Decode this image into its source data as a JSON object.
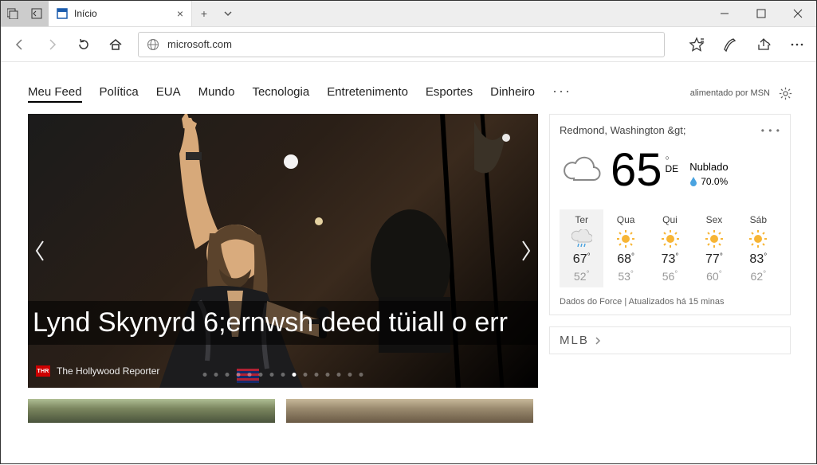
{
  "tab": {
    "title": "Início"
  },
  "address": {
    "url": "microsoft.com"
  },
  "nav": {
    "items": [
      "Meu Feed",
      "Política",
      "EUA",
      "Mundo",
      "Tecnologia",
      "Entretenimento",
      "Esportes",
      "Dinheiro"
    ],
    "active_index": 0,
    "more": "···",
    "powered_by": "alimentado por MSN"
  },
  "hero": {
    "headline": "Lynd Skynyrd 6;ernwsh deed tüiall o err",
    "source": "The Hollywood Reporter",
    "src_badge": "THR",
    "dot_count": 15,
    "active_dot": 8
  },
  "weather": {
    "location": "Redmond, Washington &gt;",
    "temp": "65",
    "unit": "DE",
    "condition": "Nublado",
    "humidity": "70.0%",
    "days": [
      {
        "name": "Ter",
        "icon": "rain",
        "hi": "67",
        "lo": "52"
      },
      {
        "name": "Qua",
        "icon": "sun",
        "hi": "68",
        "lo": "53"
      },
      {
        "name": "Qui",
        "icon": "sun",
        "hi": "73",
        "lo": "56"
      },
      {
        "name": "Sex",
        "icon": "sun",
        "hi": "77",
        "lo": "60"
      },
      {
        "name": "Sáb",
        "icon": "sun",
        "hi": "83",
        "lo": "62"
      }
    ],
    "updated": "Dados do Force | Atualizados há 15 minas"
  },
  "mlb": {
    "label": "MLB"
  }
}
